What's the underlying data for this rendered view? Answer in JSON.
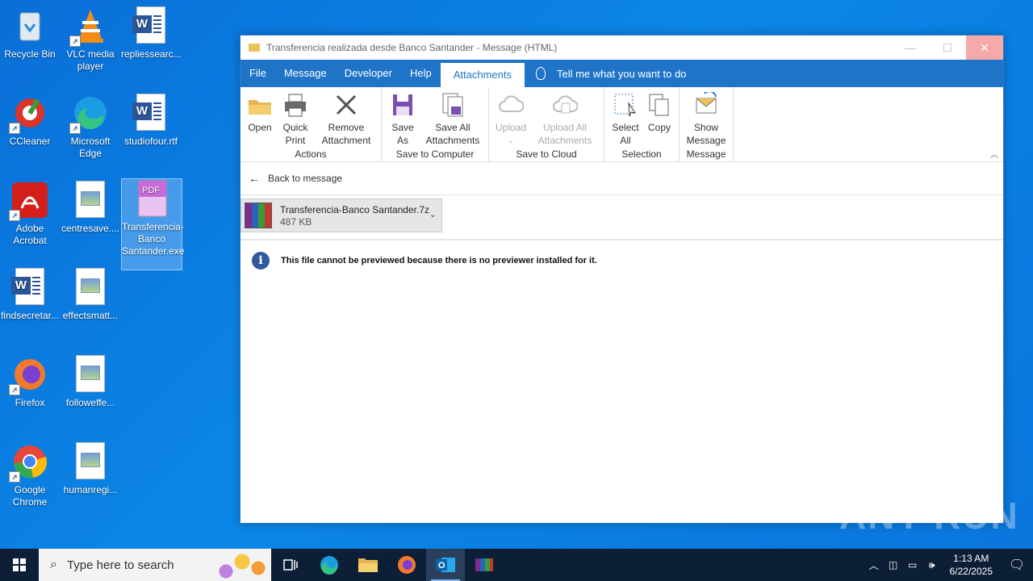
{
  "desktop": {
    "icons": [
      {
        "label": "Recycle Bin"
      },
      {
        "label": "VLC media player"
      },
      {
        "label": "repliessearc..."
      },
      {
        "label": "CCleaner"
      },
      {
        "label": "Microsoft Edge"
      },
      {
        "label": "studiofour.rtf"
      },
      {
        "label": "Adobe Acrobat"
      },
      {
        "label": "centresave...."
      },
      {
        "label": "Transferencia-Banco Santander.exe"
      },
      {
        "label": "findsecretar..."
      },
      {
        "label": "effectsmatt..."
      },
      {
        "label": "Firefox"
      },
      {
        "label": "followeffe..."
      },
      {
        "label": "Google Chrome"
      },
      {
        "label": "humanregi..."
      }
    ],
    "watermark": "ANY RUN"
  },
  "window": {
    "title": "Transferencia realizada desde Banco Santander - Message (HTML)",
    "menu": [
      "File",
      "Message",
      "Developer",
      "Help",
      "Attachments"
    ],
    "tell_me": "Tell me what you want to do",
    "ribbon": {
      "groups": [
        {
          "label": "Actions",
          "buttons": [
            "Open",
            "Quick Print",
            "Remove Attachment"
          ]
        },
        {
          "label": "Save to Computer",
          "buttons": [
            "Save As",
            "Save All Attachments"
          ]
        },
        {
          "label": "Save to Cloud",
          "buttons": [
            "Upload",
            "Upload All Attachments"
          ]
        },
        {
          "label": "Selection",
          "buttons": [
            "Select All",
            "Copy"
          ]
        },
        {
          "label": "Message",
          "buttons": [
            "Show Message"
          ]
        }
      ]
    },
    "back_label": "Back to message",
    "attachment": {
      "name": "Transferencia-Banco Santander.7z",
      "size": "487 KB"
    },
    "preview_message": "This file cannot be previewed because there is no previewer installed for it."
  },
  "taskbar": {
    "search_placeholder": "Type here to search",
    "time": "1:13 AM",
    "date": "6/22/2025"
  }
}
